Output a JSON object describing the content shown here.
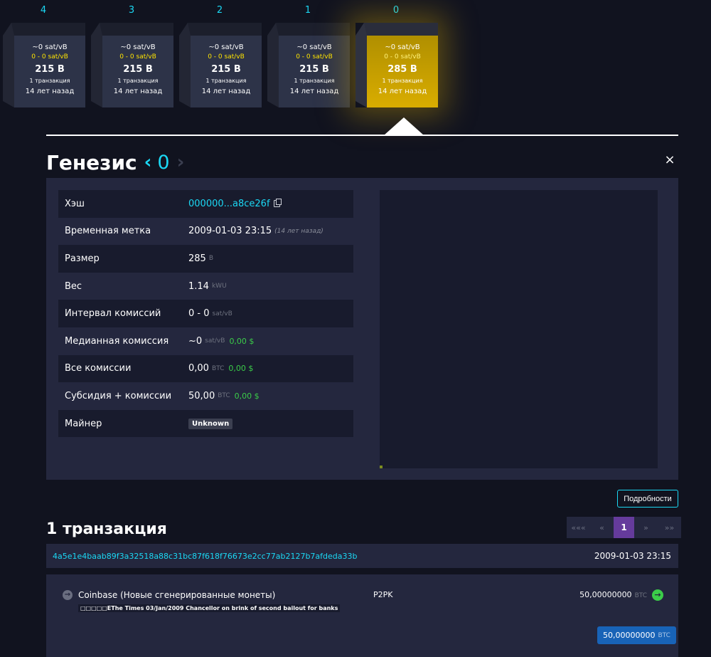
{
  "chain": {
    "blocks": [
      {
        "height": "4",
        "fee": "~0 sat/vB",
        "range": "0 - 0 sat/vB",
        "size": "215 B",
        "tx": "1 транзакция",
        "age": "14 лет назад"
      },
      {
        "height": "3",
        "fee": "~0 sat/vB",
        "range": "0 - 0 sat/vB",
        "size": "215 B",
        "tx": "1 транзакция",
        "age": "14 лет назад"
      },
      {
        "height": "2",
        "fee": "~0 sat/vB",
        "range": "0 - 0 sat/vB",
        "size": "215 B",
        "tx": "1 транзакция",
        "age": "14 лет назад"
      },
      {
        "height": "1",
        "fee": "~0 sat/vB",
        "range": "0 - 0 sat/vB",
        "size": "215 B",
        "tx": "1 транзакция",
        "age": "14 лет назад"
      },
      {
        "height": "0",
        "fee": "~0 sat/vB",
        "range": "0 - 0 sat/vB",
        "size": "285 B",
        "tx": "1 транзакция",
        "age": "14 лет назад"
      }
    ]
  },
  "header": {
    "title": "Генезис",
    "prev": "‹",
    "block_number": "0",
    "next": "›",
    "close": "×"
  },
  "details": {
    "hash_label": "Хэш",
    "hash_value": "000000...a8ce26f",
    "timestamp_label": "Временная метка",
    "timestamp_value": "2009-01-03 23:15",
    "timestamp_ago": "(14 лет назад)",
    "size_label": "Размер",
    "size_value": "285",
    "size_unit": "B",
    "weight_label": "Вес",
    "weight_value": "1.14",
    "weight_unit": "kWU",
    "fee_span_label": "Интервал комиссий",
    "fee_span_value": "0 - 0",
    "fee_span_unit": "sat/vB",
    "median_fee_label": "Медианная комиссия",
    "median_fee_value": "~0",
    "median_fee_unit": "sat/vB",
    "median_fee_usd": "0,00 $",
    "total_fees_label": "Все комиссии",
    "total_fees_value": "0,00",
    "total_fees_unit": "BTC",
    "total_fees_usd": "0,00 $",
    "subsidy_label": "Субсидия + комиссии",
    "subsidy_value": "50,00",
    "subsidy_unit": "BTC",
    "subsidy_usd": "0,00 $",
    "miner_label": "Майнер",
    "miner_value": "Unknown",
    "details_button": "Подробности"
  },
  "transactions": {
    "title": "1 транзакция",
    "pager": {
      "first": "«««",
      "prev": "«",
      "current": "1",
      "next": "»",
      "last": "»»"
    },
    "items": [
      {
        "txid": "4a5e1e4baab89f3a32518a88c31bc87f618f76673e2cc77ab2127b7afdeda33b",
        "time": "2009-01-03 23:15",
        "input_label": "Coinbase (Новые сгенерированные монеты)",
        "coinbase_message": "□□□□□EThe Times 03/Jan/2009 Chancellor on brink of second bailout for banks",
        "output_type": "P2PK",
        "output_amount": "50,00000000",
        "output_unit": "BTC",
        "total_amount": "50,00000000",
        "total_unit": "BTC"
      }
    ]
  },
  "colors": {
    "accent": "#1bd8f4",
    "background": "#11131f",
    "panel": "#24273e",
    "genesis_gold": "#d9ad00",
    "usd_green": "#3bcc49",
    "pager_active": "#653b9c",
    "total_badge": "#1863b7"
  }
}
